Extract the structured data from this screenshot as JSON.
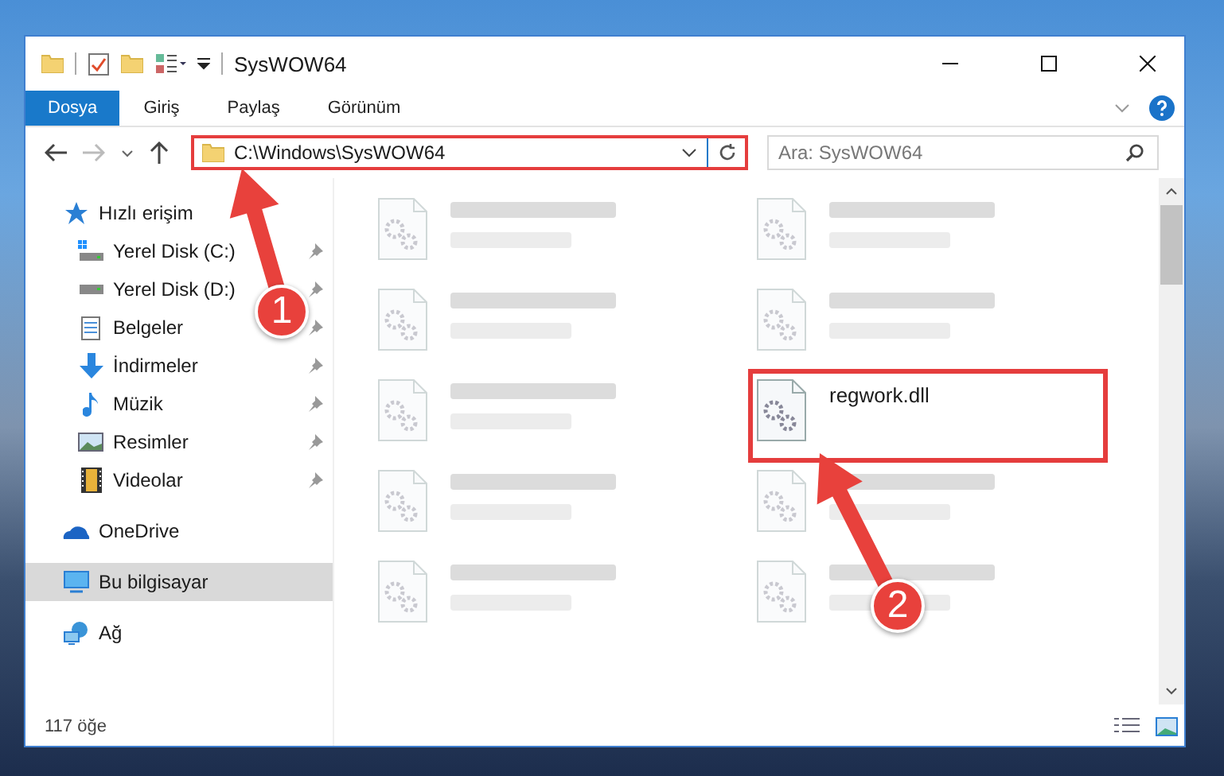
{
  "window": {
    "title": "SysWOW64"
  },
  "ribbon_tabs": [
    {
      "label": "Dosya",
      "selected": true
    },
    {
      "label": "Giriş",
      "selected": false
    },
    {
      "label": "Paylaş",
      "selected": false
    },
    {
      "label": "Görünüm",
      "selected": false
    }
  ],
  "address_bar": {
    "path": "C:\\Windows\\SysWOW64",
    "highlighted": true
  },
  "search": {
    "placeholder": "Ara: SysWOW64"
  },
  "sidebar": {
    "items": [
      {
        "label": "Hızlı erişim",
        "kind": "star",
        "selected": false,
        "children": [
          {
            "label": "Yerel Disk (C:)",
            "kind": "drive-c",
            "selected": false,
            "pinned": true
          },
          {
            "label": "Yerel Disk (D:)",
            "kind": "drive",
            "selected": false,
            "pinned": true
          },
          {
            "label": "Belgeler",
            "kind": "documents",
            "selected": false,
            "pinned": true
          },
          {
            "label": "İndirmeler",
            "kind": "downloads",
            "selected": false,
            "pinned": true
          },
          {
            "label": "Müzik",
            "kind": "music",
            "selected": false,
            "pinned": true
          },
          {
            "label": "Resimler",
            "kind": "pictures",
            "selected": false,
            "pinned": true
          },
          {
            "label": "Videolar",
            "kind": "videos",
            "selected": false,
            "pinned": true
          }
        ]
      },
      {
        "label": "OneDrive",
        "kind": "cloud",
        "selected": false
      },
      {
        "label": "Bu bilgisayar",
        "kind": "pc",
        "selected": true
      },
      {
        "label": "Ağ",
        "kind": "network",
        "selected": false
      }
    ]
  },
  "files": [
    {
      "blurred": true,
      "highlighted": false
    },
    {
      "blurred": true,
      "highlighted": false
    },
    {
      "blurred": true,
      "highlighted": false
    },
    {
      "blurred": true,
      "highlighted": false
    },
    {
      "blurred": true,
      "highlighted": false
    },
    {
      "name": "regwork.dll",
      "blurred": false,
      "highlighted": true
    },
    {
      "blurred": true,
      "highlighted": false
    },
    {
      "blurred": true,
      "highlighted": false
    },
    {
      "blurred": true,
      "highlighted": false
    },
    {
      "blurred": true,
      "highlighted": false
    }
  ],
  "status_bar": {
    "count": "117 öğe"
  },
  "annotations": [
    {
      "label": "1"
    },
    {
      "label": "2"
    }
  ]
}
